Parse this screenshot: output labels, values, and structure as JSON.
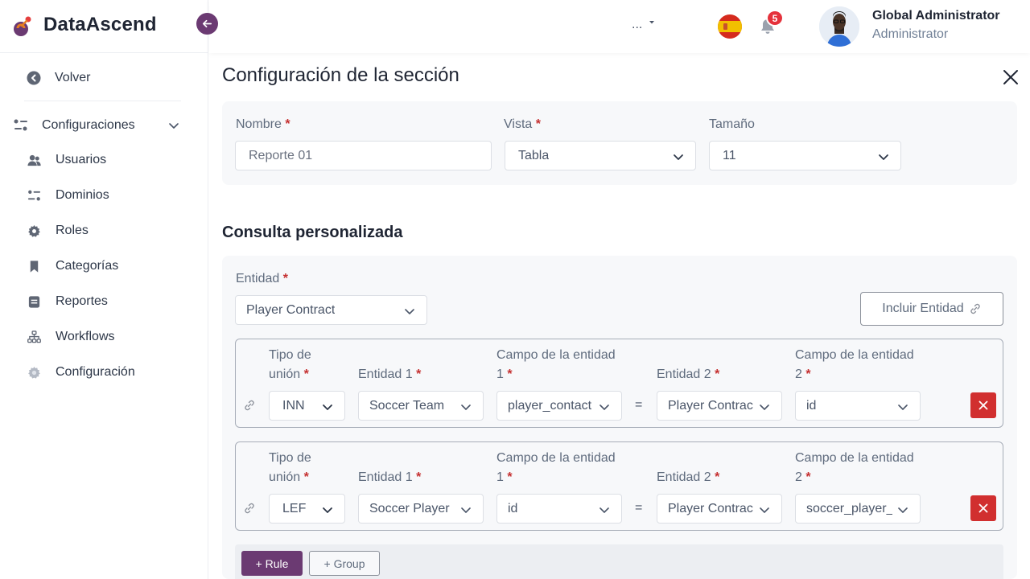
{
  "brand": {
    "name": "DataAscend"
  },
  "sidebar": {
    "back": "Volver",
    "group": "Configuraciones",
    "items": [
      {
        "label": "Usuarios",
        "icon": "users-icon"
      },
      {
        "label": "Dominios",
        "icon": "toggles-icon"
      },
      {
        "label": "Roles",
        "icon": "gear-icon"
      },
      {
        "label": "Categorías",
        "icon": "bookmark-icon"
      },
      {
        "label": "Reportes",
        "icon": "report-icon"
      },
      {
        "label": "Workflows",
        "icon": "sitemap-icon"
      },
      {
        "label": "Configuración",
        "icon": "cog-light-icon"
      }
    ]
  },
  "header": {
    "dropdown": "...",
    "notifications": "5",
    "user_name": "Global Administrator",
    "user_role": "Administrator"
  },
  "page": {
    "title": "Configuración de la sección",
    "section": {
      "name_label": "Nombre",
      "name_placeholder": "Reporte 01",
      "view_label": "Vista",
      "view_value": "Tabla",
      "size_label": "Tamaño",
      "size_value": "11"
    },
    "query": {
      "title": "Consulta personalizada",
      "entity_label": "Entidad",
      "entity_value": "Player Contract",
      "include_button": "Incluir Entidad",
      "labels": {
        "join_type_1": "Tipo de",
        "join_type_2": "unión",
        "entity1": "Entidad 1",
        "field1_1": "Campo de la entidad",
        "field1_2": "1",
        "entity2": "Entidad 2",
        "field2_1": "Campo de la entidad",
        "field2_2": "2",
        "equals": "="
      },
      "rules": [
        {
          "join": "INN",
          "entity1": "Soccer Team",
          "field1": "player_contact",
          "entity2": "Player Contrac",
          "field2": "id"
        },
        {
          "join": "LEF",
          "entity1": "Soccer Player",
          "field1": "id",
          "entity2": "Player Contrac",
          "field2": "soccer_player_"
        }
      ],
      "add_rule": "+ Rule",
      "add_group": "+ Group"
    }
  },
  "colors": {
    "primary": "#6b3a72",
    "danger": "#d12f2f",
    "required": "#c53030",
    "badge": "#e5323c"
  }
}
